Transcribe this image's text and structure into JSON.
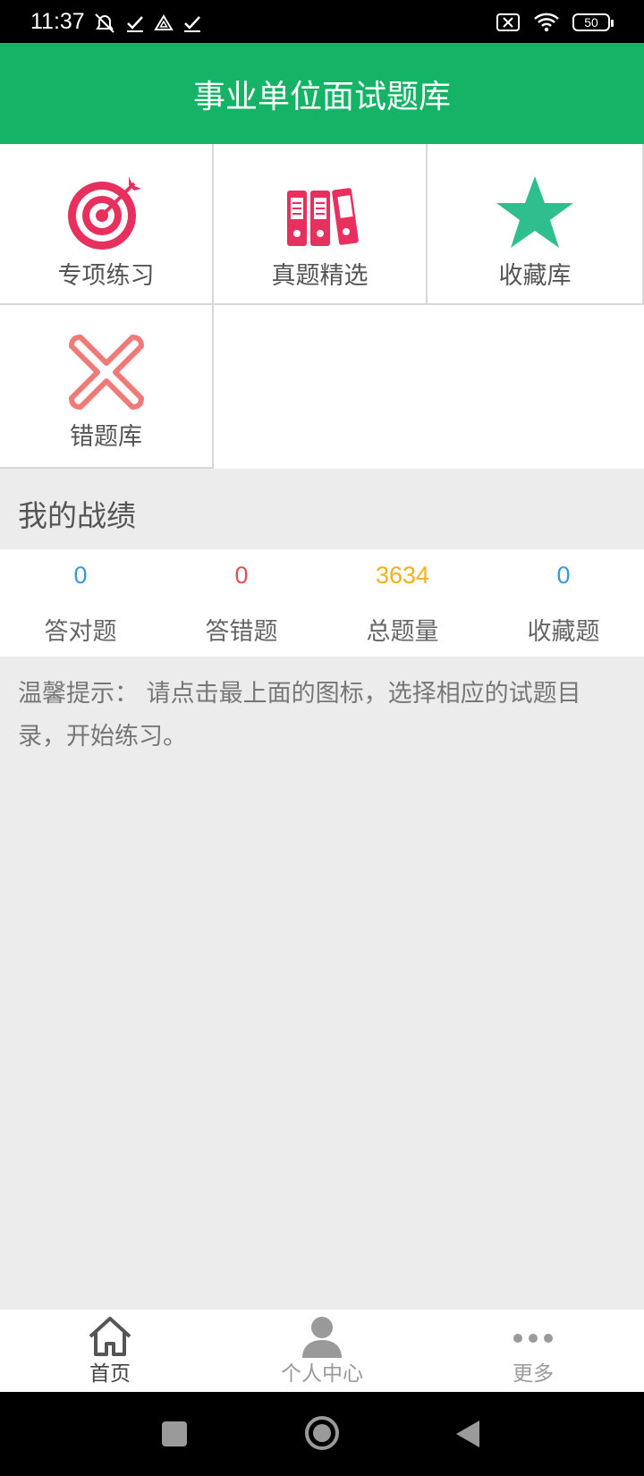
{
  "status_bar": {
    "time": "11:37",
    "battery": "50"
  },
  "header": {
    "title": "事业单位面试题库"
  },
  "menu": {
    "items": [
      {
        "label": "专项练习",
        "icon": "target-icon"
      },
      {
        "label": "真题精选",
        "icon": "binders-icon"
      },
      {
        "label": "收藏库",
        "icon": "star-icon"
      },
      {
        "label": "错题库",
        "icon": "cross-icon"
      }
    ]
  },
  "record": {
    "title": "我的战绩",
    "stats": [
      {
        "value": "0",
        "label": "答对题",
        "color": "#3a9ad9"
      },
      {
        "value": "0",
        "label": "答错题",
        "color": "#e05050"
      },
      {
        "value": "3634",
        "label": "总题量",
        "color": "#f2b01e"
      },
      {
        "value": "0",
        "label": "收藏题",
        "color": "#3a9ad9"
      }
    ]
  },
  "tip": {
    "text": "温馨提示： 请点击最上面的图标，选择相应的试题目录，开始练习。"
  },
  "bottom_nav": {
    "items": [
      {
        "label": "首页",
        "icon": "home-icon",
        "active": true
      },
      {
        "label": "个人中心",
        "icon": "person-icon",
        "active": false
      },
      {
        "label": "更多",
        "icon": "more-icon",
        "active": false
      }
    ]
  },
  "colors": {
    "accent": "#15b366",
    "pink": "#e8305e",
    "teal": "#2fbf8f",
    "salmon": "#f07a78"
  }
}
